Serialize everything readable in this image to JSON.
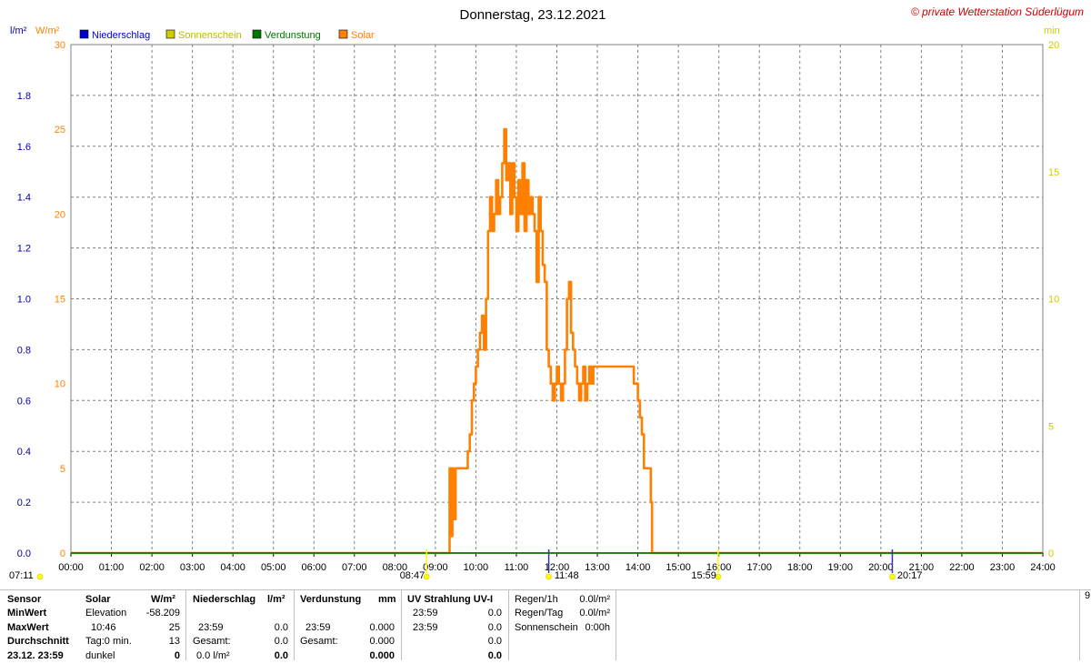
{
  "title": "Donnerstag, 23.12.2021",
  "copyright": "© private Wetterstation Süderlügum",
  "units": {
    "left1": "l/m²",
    "left2": "W/m²",
    "right": "min"
  },
  "colors": {
    "solar": "#ff8000",
    "niederschlag": "#0000ff",
    "sonnenschein": "#cccc00",
    "verdunstung": "#008000",
    "grid": "#808080"
  },
  "legend": [
    {
      "label": "Niederschlag",
      "color": "#0000cc"
    },
    {
      "label": "Sonnenschein",
      "color": "#cccc00"
    },
    {
      "label": "Verdunstung",
      "color": "#007700"
    },
    {
      "label": "Solar",
      "color": "#ff8000"
    }
  ],
  "markers": {
    "sunrise": "07:11",
    "civil_dawn": "08:47",
    "noon": "11:48",
    "civil_dusk": "15:59",
    "sunset": "20:17"
  },
  "chart_data": {
    "type": "line",
    "title": "Donnerstag, 23.12.2021",
    "x_unit": "hours",
    "x_ticks": [
      "00:00",
      "01:00",
      "02:00",
      "03:00",
      "04:00",
      "05:00",
      "06:00",
      "07:00",
      "08:00",
      "09:00",
      "10:00",
      "11:00",
      "12:00",
      "13:00",
      "14:00",
      "15:00",
      "16:00",
      "17:00",
      "18:00",
      "19:00",
      "20:00",
      "21:00",
      "22:00",
      "23:00",
      "24:00"
    ],
    "xlim": [
      0,
      24
    ],
    "axes": {
      "left_precip": {
        "label": "l/m²",
        "ylim": [
          0,
          2.0
        ],
        "ticks": [
          "0.0",
          "0.2",
          "0.4",
          "0.6",
          "0.8",
          "1.0",
          "1.2",
          "1.4",
          "1.6",
          "1.8"
        ]
      },
      "left_solar": {
        "label": "W/m²",
        "ylim": [
          0,
          30
        ],
        "ticks": [
          "0",
          "5",
          "10",
          "15",
          "20",
          "25",
          "30"
        ]
      },
      "right_minutes": {
        "label": "min",
        "ylim": [
          0,
          20
        ],
        "ticks": [
          "0",
          "5",
          "10",
          "15",
          "20"
        ]
      }
    },
    "grid": true,
    "series": [
      {
        "name": "Solar",
        "axis": "left_solar",
        "color": "#ff8000",
        "x": [
          0,
          9.35,
          9.35,
          9.38,
          9.42,
          9.45,
          9.5,
          9.55,
          9.75,
          9.8,
          9.85,
          9.9,
          9.95,
          10.0,
          10.05,
          10.1,
          10.15,
          10.2,
          10.25,
          10.3,
          10.35,
          10.4,
          10.45,
          10.5,
          10.55,
          10.6,
          10.65,
          10.7,
          10.75,
          10.8,
          10.85,
          10.9,
          10.95,
          11.0,
          11.05,
          11.1,
          11.15,
          11.2,
          11.25,
          11.3,
          11.35,
          11.4,
          11.45,
          11.5,
          11.55,
          11.6,
          11.65,
          11.7,
          11.75,
          11.8,
          11.85,
          11.9,
          11.95,
          12.0,
          12.05,
          12.1,
          12.15,
          12.2,
          12.25,
          12.3,
          12.35,
          12.4,
          12.45,
          12.5,
          12.55,
          12.6,
          12.65,
          12.7,
          12.75,
          12.8,
          12.85,
          12.9,
          12.95,
          13.0,
          13.05,
          13.1,
          13.15,
          13.2,
          13.25,
          13.3,
          13.35,
          13.4,
          13.5,
          13.6,
          13.7,
          13.8,
          13.9,
          14.0,
          14.05,
          14.1,
          14.15,
          14.2,
          14.3,
          14.32,
          14.35,
          24
        ],
        "values": [
          0,
          0,
          5,
          1,
          5,
          2,
          5,
          5,
          5,
          6,
          7,
          9,
          10,
          11,
          12,
          13,
          14,
          12,
          15,
          19,
          21,
          19,
          20,
          22,
          20,
          21,
          23,
          25,
          22,
          23,
          20,
          23,
          21,
          19,
          22,
          20,
          23,
          19,
          22,
          20,
          21,
          20,
          19,
          16,
          21,
          19,
          17,
          16,
          12,
          11,
          10,
          9,
          10,
          11,
          10,
          9,
          10,
          12,
          15,
          16,
          13,
          12,
          11,
          10,
          9,
          10,
          11,
          9,
          10,
          11,
          10,
          11,
          11,
          11,
          11,
          11,
          11,
          11,
          11,
          11,
          11,
          11,
          11,
          11,
          11,
          11,
          10,
          9,
          8,
          7,
          5,
          5,
          5,
          3,
          0,
          0
        ]
      },
      {
        "name": "Niederschlag",
        "axis": "left_precip",
        "color": "#0000cc",
        "x": [
          0,
          24
        ],
        "values": [
          0,
          0
        ]
      },
      {
        "name": "Sonnenschein",
        "axis": "right_minutes",
        "color": "#cccc00",
        "x": [
          0,
          24
        ],
        "values": [
          0,
          0
        ]
      },
      {
        "name": "Verdunstung",
        "axis": "left_precip",
        "color": "#007700",
        "x": [
          0,
          24
        ],
        "values": [
          0,
          0
        ]
      }
    ]
  },
  "stats": {
    "sensor_col": {
      "header": "Sensor",
      "min": "MinWert",
      "max": "MaxWert",
      "avg": "Durchschnitt",
      "date": "23.12. 23:59"
    },
    "solar": {
      "header": "Solar",
      "unit": "W/m²",
      "min_label": "Elevation",
      "min_val": "-58.209",
      "max_time": "10:46",
      "max_val": "25",
      "avg_label": "Tag:0 min.",
      "avg_val": "13",
      "last_label": "dunkel",
      "last_val": "0"
    },
    "niederschlag": {
      "header": "Niederschlag",
      "unit": "l/m²",
      "min_time": "",
      "min_val": "",
      "max_time": "23:59",
      "max_val": "0.0",
      "avg_label": "Gesamt:",
      "avg_val": "0.0",
      "last_label": "0.0 l/m²",
      "last_val": "0.0"
    },
    "verdunstung": {
      "header": "Verdunstung",
      "unit": "mm",
      "max_time": "23:59",
      "max_val": "0.000",
      "avg_label": "Gesamt:",
      "avg_val": "0.000",
      "last_val": "0.000"
    },
    "uv": {
      "header": "UV Strahlung UV-I",
      "min_time": "23:59",
      "min_val": "0.0",
      "max_time": "23:59",
      "max_val": "0.0",
      "avg_val": "0.0",
      "last_val": "0.0"
    },
    "regen": {
      "r1h_label": "Regen/1h",
      "r1h_val": "0.0l/m²",
      "rtag_label": "Regen/Tag",
      "rtag_val": "0.0l/m²",
      "sonne_label": "Sonnenschein",
      "sonne_val": "0:00h"
    },
    "edge": "9"
  }
}
